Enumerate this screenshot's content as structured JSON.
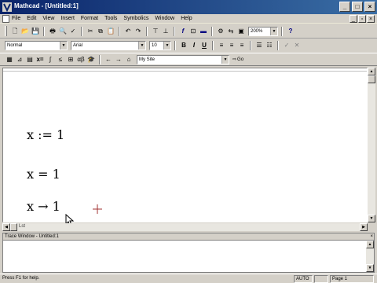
{
  "window": {
    "title": "Mathcad - [Untitled:1]"
  },
  "menu": [
    {
      "id": "file",
      "label": "File"
    },
    {
      "id": "edit",
      "label": "Edit"
    },
    {
      "id": "view",
      "label": "View"
    },
    {
      "id": "insert",
      "label": "Insert"
    },
    {
      "id": "format",
      "label": "Format"
    },
    {
      "id": "tools",
      "label": "Tools"
    },
    {
      "id": "symbolics",
      "label": "Symbolics"
    },
    {
      "id": "window",
      "label": "Window"
    },
    {
      "id": "help",
      "label": "Help"
    }
  ],
  "toolbar": {
    "zoom": "200%"
  },
  "formatting": {
    "style": "Normal",
    "font": "Arial",
    "size": "10",
    "bold": "B",
    "italic": "I",
    "underline": "U"
  },
  "resources": {
    "site": "My Site",
    "go_label": "Go"
  },
  "worksheet": {
    "expr1": {
      "var": "x",
      "op": ":=",
      "val": "1"
    },
    "expr2": {
      "var": "x",
      "op": "=",
      "val": "1"
    },
    "expr3": {
      "var": "x",
      "op": "→",
      "val": "1"
    },
    "hscroll_label": "Lst"
  },
  "trace": {
    "title": "Trace Window - Untitled:1"
  },
  "status": {
    "message": "Press F1 for help.",
    "mode": "AUTO",
    "page": "Page 1"
  }
}
